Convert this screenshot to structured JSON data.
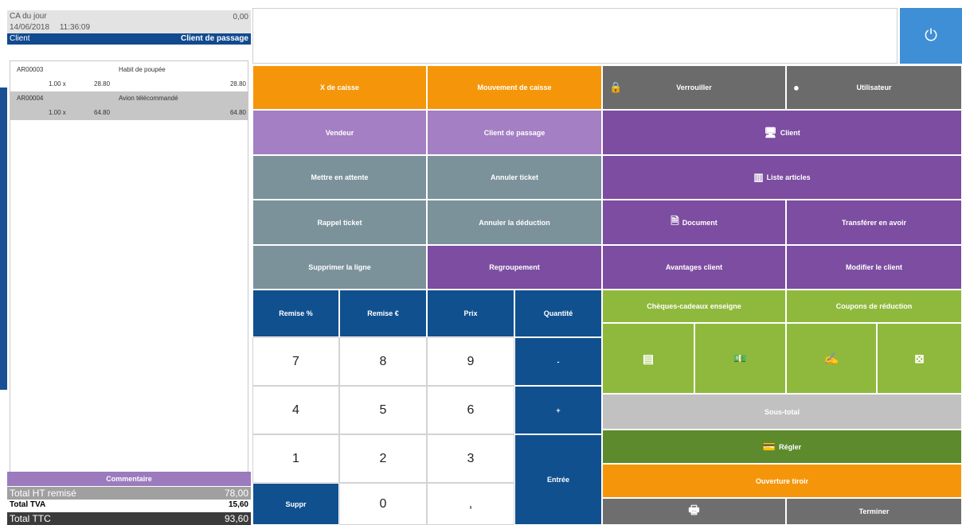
{
  "ticket": {
    "ca_label": "CA du jour",
    "ca_value": "0,00",
    "date": "14/06/2018",
    "time": "11:36:09",
    "client_label": "Client",
    "client_value": "Client de passage",
    "lines": [
      {
        "code": "AR00003",
        "desc": "Habit de poupée",
        "qty": "1.00 x",
        "price": "28.80",
        "total": "28.80",
        "selected": false
      },
      {
        "code": "AR00004",
        "desc": "Avion télécommandé",
        "qty": "1.00 x",
        "price": "64.80",
        "total": "64.80",
        "selected": true
      }
    ],
    "comment_label": "Commentaire",
    "total_ht_label": "Total HT remisé",
    "total_ht": "78,00",
    "total_tva_label": "Total TVA",
    "total_tva": "15,60",
    "total_ttc_label": "Total TTC",
    "total_ttc": "93,60"
  },
  "buttons": {
    "x_caisse": "X de caisse",
    "mouvement": "Mouvement de caisse",
    "verrouiller": "Verrouiller",
    "utilisateur": "Utilisateur",
    "vendeur": "Vendeur",
    "client_passage": "Client de passage",
    "client": "Client",
    "attente": "Mettre en attente",
    "annuler_ticket": "Annuler ticket",
    "liste_articles": "Liste articles",
    "rappel": "Rappel ticket",
    "annuler_deduction": "Annuler la déduction",
    "document": "Document",
    "transferer": "Transférer en avoir",
    "supprimer_ligne": "Supprimer la ligne",
    "regroupement": "Regroupement",
    "avantages": "Avantages client",
    "modifier_client": "Modifier le client",
    "remise_pct": "Remise %",
    "remise_eur": "Remise €",
    "prix": "Prix",
    "quantite": "Quantité",
    "cheques": "Chèques-cadeaux enseigne",
    "coupons": "Coupons de réduction",
    "sous_total": "Sous-total",
    "regler": "Régler",
    "ouverture": "Ouverture tiroir",
    "terminer": "Terminer",
    "suppr": "Suppr",
    "entree": "Entrée"
  },
  "keypad": {
    "k7": "7",
    "k8": "8",
    "k9": "9",
    "minus": "-",
    "k4": "4",
    "k5": "5",
    "k6": "6",
    "plus": "+",
    "k1": "1",
    "k2": "2",
    "k3": "3",
    "k0": "0",
    "comma": ","
  },
  "icons": {
    "power": "power-icon",
    "lock": "lock-icon",
    "user": "user-icon",
    "monitor": "monitor-icon",
    "barcode": "barcode-icon",
    "document": "document-icon",
    "card": "card-icon",
    "cash": "cash-icon",
    "cheque": "cheque-icon",
    "voucher": "voucher-icon",
    "pay": "pay-icon",
    "printer": "printer-icon"
  },
  "colors": {
    "orange": "#f5960a",
    "purple": "#7c4da0",
    "navy": "#11508f",
    "lime": "#8fb93c"
  }
}
